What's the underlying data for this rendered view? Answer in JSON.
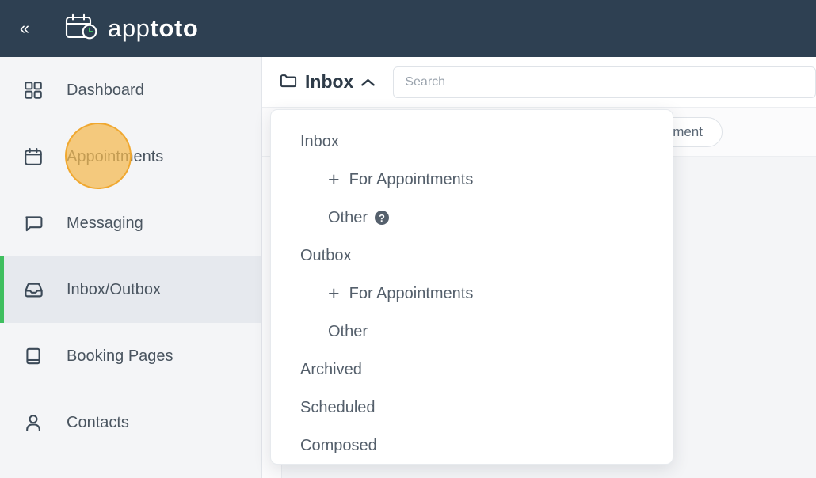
{
  "topbar": {
    "collapse_icon": "double-chevron-left-icon",
    "logo_icon": "calendar-clock-icon",
    "brand_light": "app",
    "brand_bold": "toto"
  },
  "sidebar": {
    "items": [
      {
        "label": "Dashboard",
        "icon": "grid-icon",
        "active": false
      },
      {
        "label": "Appointments",
        "icon": "calendar-icon",
        "active": false
      },
      {
        "label": "Messaging",
        "icon": "chat-icon",
        "active": false
      },
      {
        "label": "Inbox/Outbox",
        "icon": "inbox-icon",
        "active": true
      },
      {
        "label": "Booking Pages",
        "icon": "book-icon",
        "active": false
      },
      {
        "label": "Contacts",
        "icon": "person-icon",
        "active": false
      }
    ],
    "active_accent": "#3fbf5f"
  },
  "cursor_highlight": {
    "target": "Appointments",
    "fill": "#f4b94d",
    "border": "#f0a830"
  },
  "main": {
    "header": {
      "folder_icon": "folder-icon",
      "folder_name": "Inbox",
      "chevron_icon": "chevron-up-icon"
    },
    "search": {
      "placeholder": "Search",
      "value": ""
    },
    "filters": {
      "attachment_label": "Attachment"
    }
  },
  "dropdown": {
    "items": [
      {
        "label": "Inbox",
        "level": 0,
        "plus": false,
        "help": false
      },
      {
        "label": "For Appointments",
        "level": 1,
        "plus": true,
        "help": false
      },
      {
        "label": "Other",
        "level": 1,
        "plus": false,
        "help": true
      },
      {
        "label": "Outbox",
        "level": 0,
        "plus": false,
        "help": false
      },
      {
        "label": "For Appointments",
        "level": 1,
        "plus": true,
        "help": false
      },
      {
        "label": "Other",
        "level": 1,
        "plus": false,
        "help": false
      },
      {
        "label": "Archived",
        "level": 0,
        "plus": false,
        "help": false
      },
      {
        "label": "Scheduled",
        "level": 0,
        "plus": false,
        "help": false
      },
      {
        "label": "Composed",
        "level": 0,
        "plus": false,
        "help": false
      }
    ],
    "help_glyph": "?"
  }
}
